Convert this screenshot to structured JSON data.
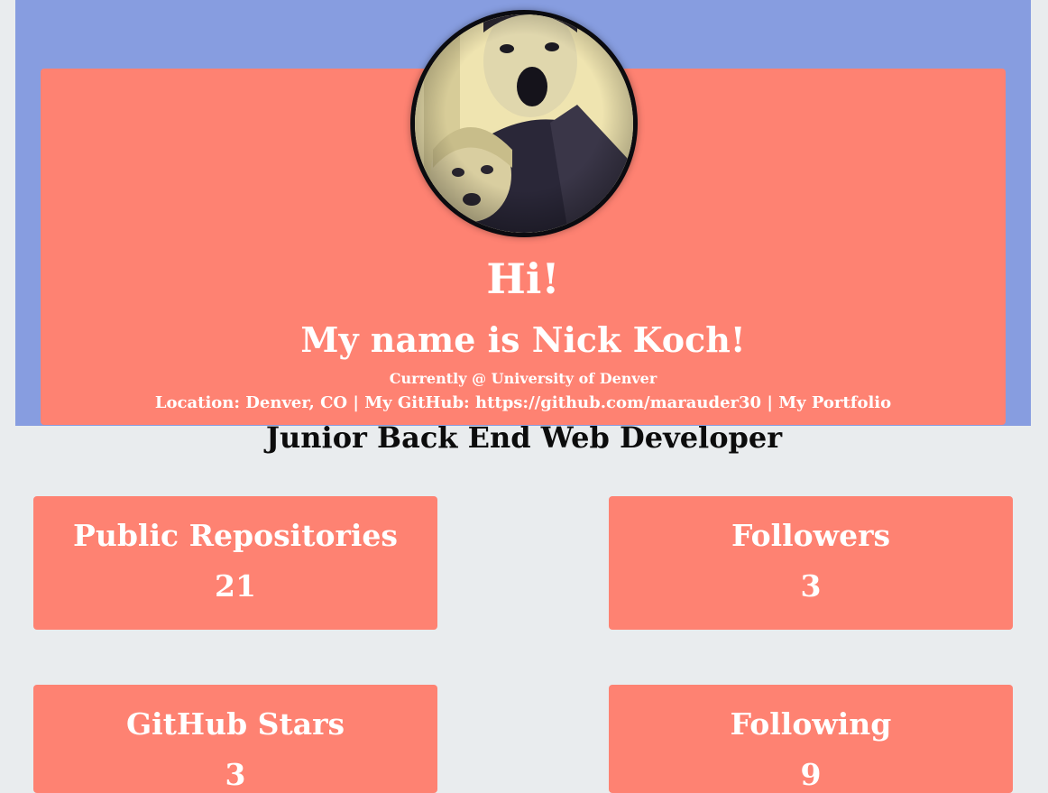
{
  "hero": {
    "greeting": "Hi!",
    "name_line": "My name is Nick Koch!",
    "current": "Currently @ University of Denver",
    "location_label": "Location: Denver, CO",
    "separator": "|",
    "github_prefix": "My GitHub:",
    "github_url": "https://github.com/marauder30",
    "portfolio_label": "My Portfolio",
    "avatar_icon": "profile-photo"
  },
  "role": "Junior Back End Web Developer",
  "stats": [
    {
      "label": "Public Repositories",
      "value": "21"
    },
    {
      "label": "Followers",
      "value": "3"
    },
    {
      "label": "GitHub Stars",
      "value": "3"
    },
    {
      "label": "Following",
      "value": "9"
    }
  ],
  "colors": {
    "page_bg": "#e9ecee",
    "hero_bg": "#879de0",
    "card_bg": "#fe8272",
    "text_light": "#ffffff",
    "text_dark": "#0c0c0c"
  }
}
